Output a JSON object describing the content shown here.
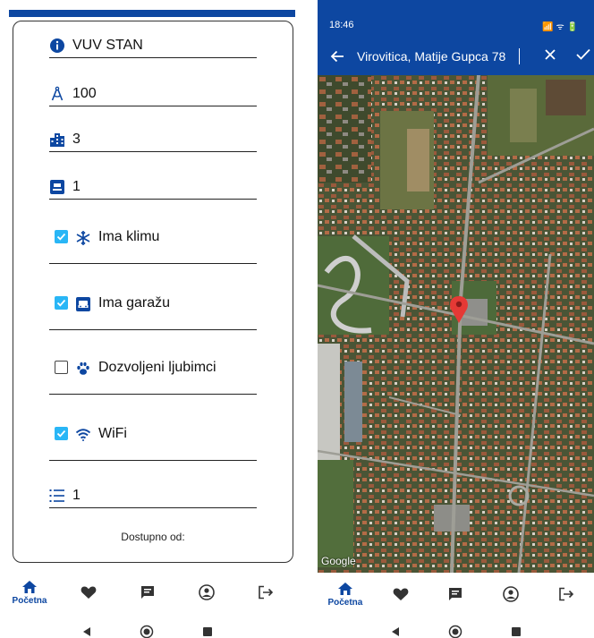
{
  "left": {
    "fields": [
      {
        "icon": "info-icon",
        "value": "VUV STAN"
      },
      {
        "icon": "compass-icon",
        "value": "100"
      },
      {
        "icon": "building-icon",
        "value": "3"
      },
      {
        "icon": "door-icon",
        "value": "1"
      }
    ],
    "checkboxes": [
      {
        "icon": "snowflake-icon",
        "label": "Ima klimu",
        "checked": true
      },
      {
        "icon": "garage-icon",
        "label": "Ima garažu",
        "checked": true
      },
      {
        "icon": "paw-icon",
        "label": "Dozvoljeni ljubimci",
        "checked": false
      },
      {
        "icon": "wifi-icon",
        "label": "WiFi",
        "checked": true
      }
    ],
    "list_field": {
      "icon": "list-icon",
      "value": "1"
    },
    "available_from_label": "Dostupno od:"
  },
  "nav": {
    "items": [
      {
        "name": "home-icon",
        "label": "Početna",
        "active": true
      },
      {
        "name": "heart-icon",
        "label": "",
        "active": false
      },
      {
        "name": "chat-icon",
        "label": "",
        "active": false
      },
      {
        "name": "account-icon",
        "label": "",
        "active": false
      },
      {
        "name": "logout-icon",
        "label": "",
        "active": false
      }
    ]
  },
  "right": {
    "status_time": "18:46",
    "status_icons": "📶 ᯤ 🔋",
    "search_query": "Virovitica, Matije Gupca 78",
    "map_attribution": "Google"
  },
  "colors": {
    "primary": "#0d47a1",
    "checkbox": "#29b6f6",
    "pin": "#e53935"
  }
}
